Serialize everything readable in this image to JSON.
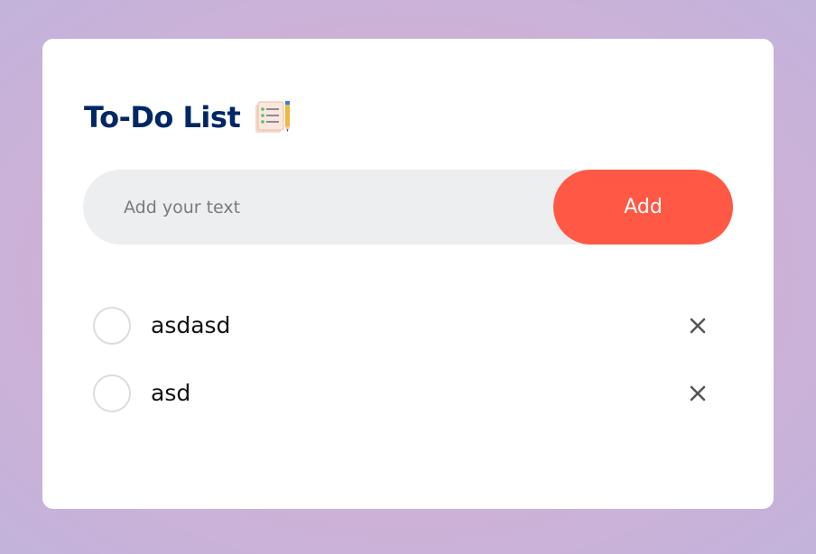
{
  "app": {
    "title": "To-Do List",
    "title_icon": "notepad-pencil-icon"
  },
  "input": {
    "placeholder": "Add your text",
    "value": ""
  },
  "add_button": {
    "label": "Add"
  },
  "tasks": [
    {
      "text": "asdasd",
      "checked": false
    },
    {
      "text": "asd",
      "checked": false
    }
  ],
  "colors": {
    "title": "#002765",
    "accent": "#ff5945",
    "input_bg": "#edeef0",
    "circle_border": "#dcdcdc",
    "delete_icon": "#555555"
  }
}
